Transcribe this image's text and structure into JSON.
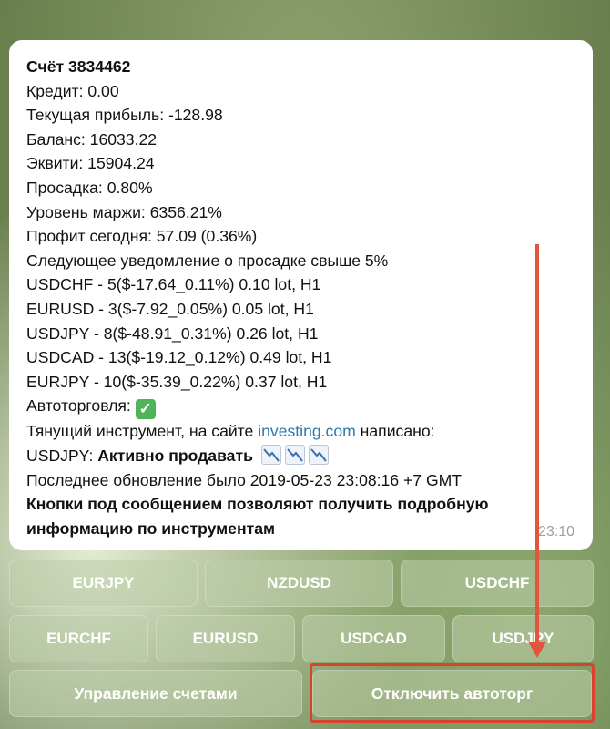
{
  "message": {
    "account": "Счёт 3834462",
    "credit": "Кредит: 0.00",
    "current_profit": "Текущая прибыль: -128.98",
    "balance": "Баланс: 16033.22",
    "equity": "Эквити: 15904.24",
    "drawdown": "Просадка: 0.80%",
    "margin_level": "Уровень маржи: 6356.21%",
    "profit_today": "Профит сегодня: 57.09 (0.36%)",
    "next_notification": "Следующее уведомление о просадке свыше 5%",
    "positions": [
      "USDCHF - 5($-17.64_0.11%) 0.10 lot, H1",
      "EURUSD - 3($-7.92_0.05%) 0.05 lot, H1",
      "USDJPY - 8($-48.91_0.31%) 0.26 lot, H1",
      "USDCAD - 13($-19.12_0.12%) 0.49 lot, H1",
      "EURJPY - 10($-35.39_0.22%) 0.37 lot, H1"
    ],
    "autotrade_label": "Автоторговля:",
    "autotrade_check": "✓",
    "pulling_prefix": "Тянущий инструмент, на сайте ",
    "pulling_link": "investing.com",
    "pulling_suffix": " написано:",
    "signal_symbol": "USDJPY: ",
    "signal_action": "Активно продавать",
    "last_update": "Последнее обновление было 2019-05-23 23:08:16 +7 GMT",
    "hint_line1": "Кнопки под сообщением позволяют получить подробную",
    "hint_line2": "информацию по инструментам",
    "time": "23:10"
  },
  "keyboard": {
    "row1": [
      "EURJPY",
      "NZDUSD",
      "USDCHF"
    ],
    "row2": [
      "EURCHF",
      "EURUSD",
      "USDCAD",
      "USDJPY"
    ],
    "row3": [
      "Управление счетами",
      "Отключить автоторг"
    ]
  },
  "colors": {
    "link": "#2a7ab3",
    "highlight": "#d8432e",
    "check": "#4fb35a"
  },
  "icons": {
    "autotrade_status": "check-mark-button-icon",
    "trend": "chart-decreasing-icon"
  }
}
